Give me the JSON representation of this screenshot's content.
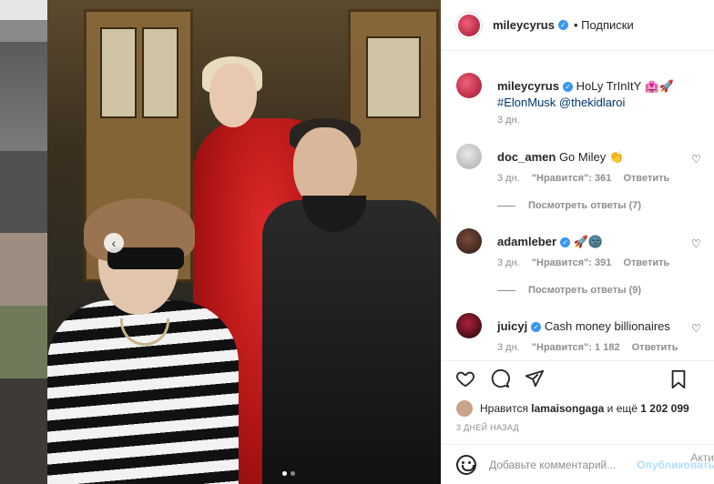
{
  "post": {
    "username": "mileycyrus",
    "follow_label": "• Подписки",
    "verified_mark": "✓",
    "caption_user": "mileycyrus",
    "caption_text": "HoLy TrInItY 🏩🚀",
    "caption_tags": "#ElonMusk @thekidlaroi",
    "caption_time": "3 дн."
  },
  "comments": [
    {
      "user": "doc_amen",
      "verified": false,
      "text": "Go Miley 👏",
      "time": "3 дн.",
      "likes": "\"Нравится\": 361",
      "reply": "Ответить",
      "view_replies": "Посмотреть ответы (7)"
    },
    {
      "user": "adamleber",
      "verified": true,
      "text": "🚀🌚",
      "time": "3 дн.",
      "likes": "\"Нравится\": 391",
      "reply": "Ответить",
      "view_replies": "Посмотреть ответы (9)"
    },
    {
      "user": "juicyj",
      "verified": true,
      "text": "Cash money billionaires",
      "time": "3 дн.",
      "likes": "\"Нравится\": 1 182",
      "reply": "Ответить"
    }
  ],
  "likes": {
    "prefix": "Нравится",
    "user": "lamaisongaga",
    "middle": "и ещё",
    "count": "1 202 099"
  },
  "post_date": "3 ДНЕЙ НАЗАД",
  "add_comment": {
    "placeholder": "Добавьте комментарий...",
    "publish_label": "Опубликовать"
  },
  "watermark": "Акти",
  "colors": {
    "verified": "#3897f0",
    "text": "#262626",
    "muted": "#8e8e8e",
    "link": "#00376b",
    "publish_disabled": "#b2dffc"
  },
  "icons": {
    "carousel_prev": "chevron-left-icon",
    "like": "heart-icon",
    "comment": "comment-bubble-icon",
    "share": "paper-plane-icon",
    "save": "bookmark-icon",
    "emoji": "smiley-icon"
  },
  "carousel": {
    "total": 2,
    "active": 1
  }
}
